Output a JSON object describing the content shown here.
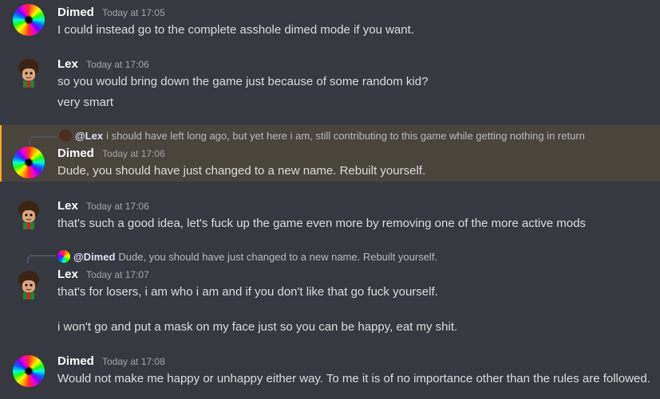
{
  "messages": [
    {
      "user": "Dimed",
      "time": "Today at 17:05",
      "lines": [
        "I could instead go to the complete asshole dimed mode if you want."
      ]
    },
    {
      "user": "Lex",
      "time": "Today at 17:06",
      "lines": [
        "so you would bring down the game just because of some random kid?",
        "very smart"
      ]
    },
    {
      "user": "Dimed",
      "time": "Today at 17:06",
      "reply": {
        "mention": "@Lex",
        "text": "i should have left long ago, but yet here i am, still contributing to this game while getting nothing in return"
      },
      "lines": [
        "Dude, you should have just changed to a new name. Rebuilt yourself."
      ]
    },
    {
      "user": "Lex",
      "time": "Today at 17:06",
      "lines": [
        "that's such a good idea, let's fuck up the game even more by removing one of the more active mods"
      ]
    },
    {
      "user": "Lex",
      "time": "Today at 17:07",
      "reply": {
        "mention": "@Dimed",
        "text": "Dude, you should have just changed to a new name. Rebuilt yourself."
      },
      "lines": [
        "that's for losers, i am who i am and if you don't like that go fuck yourself.",
        "i won't go and put a mask on my face just so you can be happy, eat my shit."
      ]
    },
    {
      "user": "Dimed",
      "time": "Today at 17:08",
      "lines": [
        "Would not make me happy or unhappy either way. To me it is of no importance other than the rules are followed."
      ]
    }
  ],
  "colors": {
    "background": "#36393f",
    "highlight": "#49443c",
    "highlight_border": "#faa81a"
  },
  "icons": {
    "dimed_avatar": "rainbow-spiral-avatar-icon",
    "lex_avatar": "cartoon-boy-avatar-icon"
  }
}
